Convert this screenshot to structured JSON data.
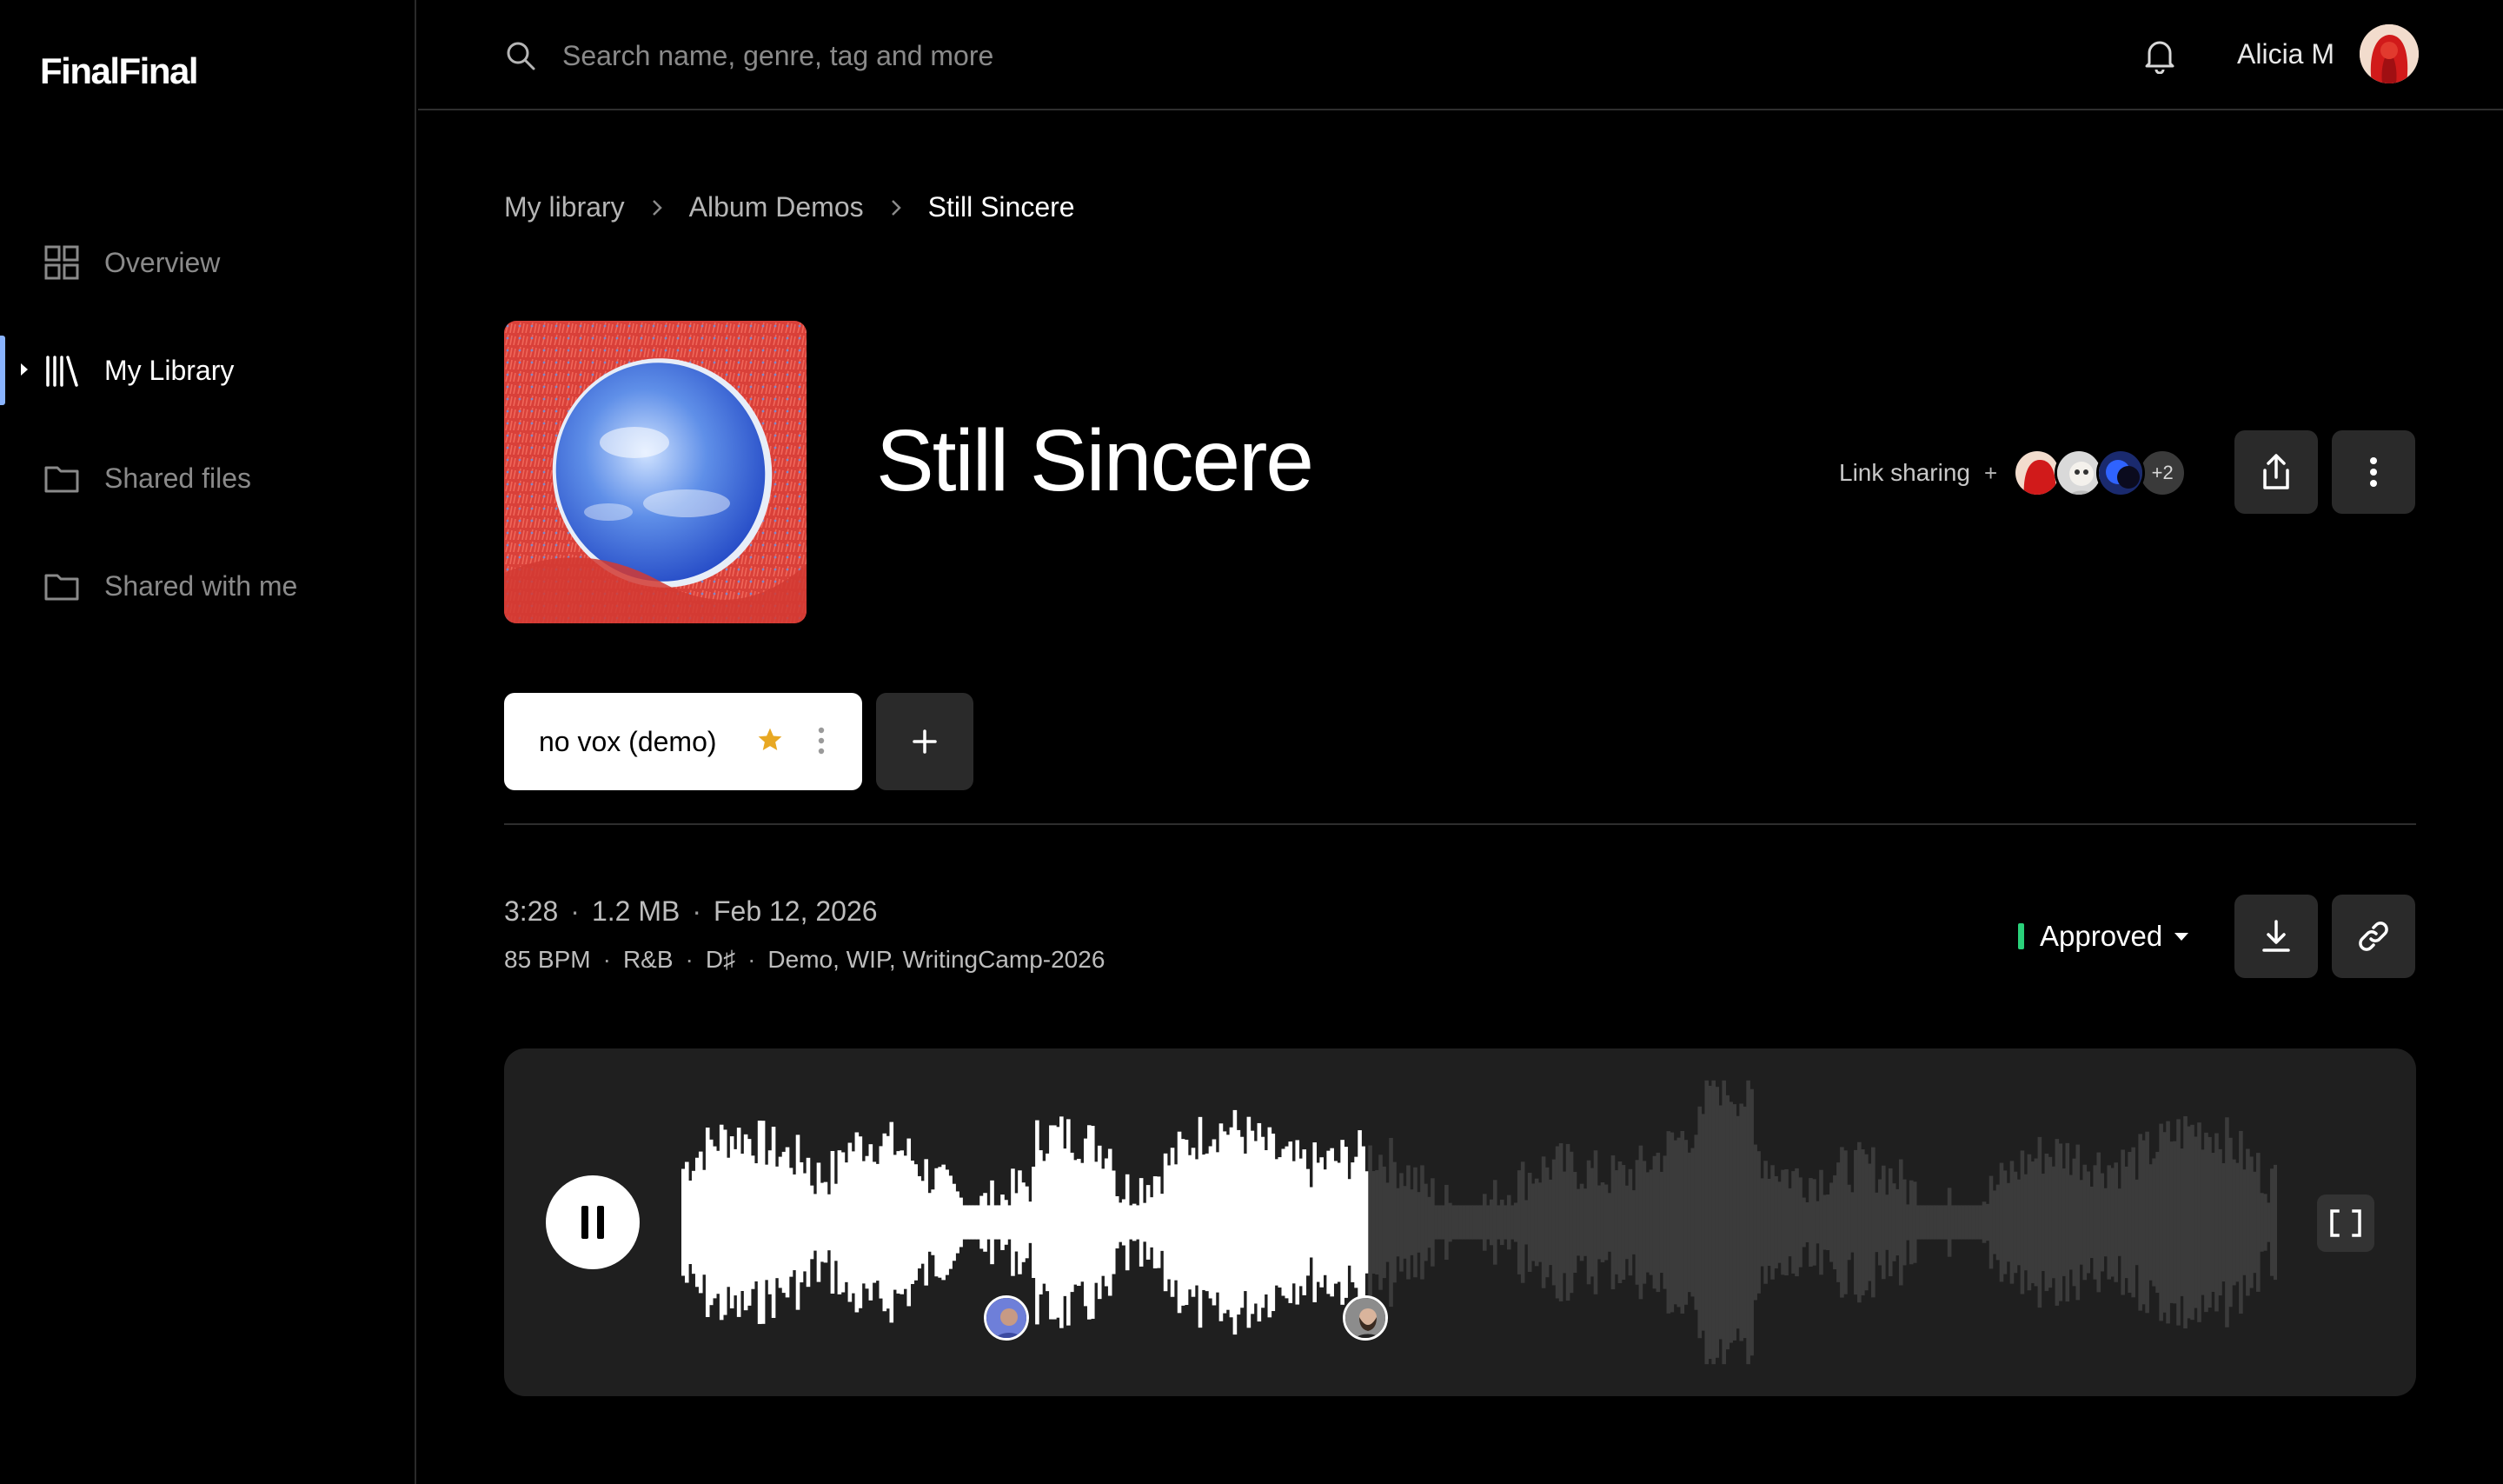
{
  "app": {
    "logo": "FinalFinal"
  },
  "sidebar": {
    "items": [
      {
        "label": "Overview",
        "icon": "grid-icon",
        "active": false
      },
      {
        "label": "My Library",
        "icon": "library-icon",
        "active": true
      },
      {
        "label": "Shared files",
        "icon": "folder-icon",
        "active": false
      },
      {
        "label": "Shared with me",
        "icon": "folder-icon",
        "active": false
      }
    ]
  },
  "topbar": {
    "search_placeholder": "Search name, genre, tag and more",
    "user_name": "Alicia M"
  },
  "breadcrumb": [
    "My library",
    "Album Demos",
    "Still Sincere"
  ],
  "track": {
    "title": "Still Sincere",
    "link_sharing_label": "Link sharing",
    "link_sharing_plus": "+",
    "collaborators_more": "+2"
  },
  "versions": {
    "active_label": "no vox (demo)",
    "starred": true,
    "add_label": "+"
  },
  "meta": {
    "duration": "3:28",
    "size": "1.2 MB",
    "date": "Feb 12, 2026",
    "bpm": "85 BPM",
    "genre": "R&B",
    "key": "D♯",
    "tags": "Demo, WIP, WritingCamp-2026"
  },
  "status": {
    "label": "Approved",
    "color": "#2ad17a"
  },
  "player": {
    "state": "playing",
    "progress": 0.43
  },
  "colors": {
    "accent": "#8ab4ff",
    "star": "#e8a823"
  }
}
